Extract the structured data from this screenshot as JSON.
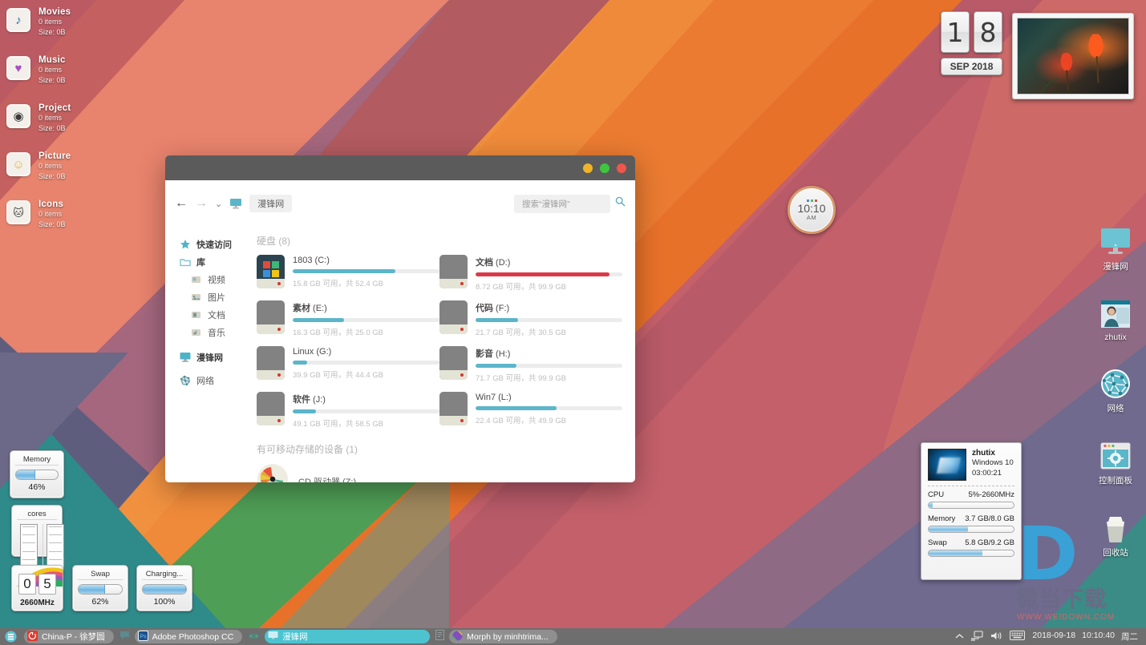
{
  "desktop": {
    "left_icons": [
      {
        "name": "Movies",
        "items": "0 items",
        "size": "Size: 0B",
        "glyph": "♪",
        "icon_color": "#2b6fa8"
      },
      {
        "name": "Music",
        "items": "0 items",
        "size": "Size: 0B",
        "glyph": "♥",
        "icon_color": "#a64ec2"
      },
      {
        "name": "Project",
        "items": "0 items",
        "size": "Size: 0B",
        "glyph": "◉",
        "icon_color": "#3b3b3b"
      },
      {
        "name": "Picture",
        "items": "0 items",
        "size": "Size: 0B",
        "glyph": "😃",
        "icon_color": "#e8b13c"
      },
      {
        "name": "Icons",
        "items": "0 items",
        "size": "Size: 0B",
        "glyph": "🐱",
        "icon_color": "#4a4a4a"
      }
    ],
    "right_icons": [
      {
        "label": "漫锋网",
        "icon": "monitor-icon"
      },
      {
        "label": "zhutix",
        "icon": "user-photo-icon"
      },
      {
        "label": "网络",
        "icon": "network-globe-icon"
      },
      {
        "label": "控制面板",
        "icon": "control-panel-icon"
      },
      {
        "label": "回收站",
        "icon": "recycle-bin-icon"
      }
    ],
    "watermark": {
      "logo": "D",
      "brand": "微当下载",
      "url": "WWW.WEIDOWN.COM"
    }
  },
  "gadgets": {
    "memory": {
      "title": "Memory",
      "value": "46%",
      "percent": 46
    },
    "cores": {
      "title": "cores",
      "core1": "1",
      "core2": "2"
    },
    "cpufreq": {
      "digit1": "0",
      "digit2": "5",
      "label": "2660MHz"
    },
    "swap": {
      "title": "Swap",
      "value": "62%",
      "percent": 62
    },
    "battery": {
      "title": "Charging...",
      "value": "100%",
      "percent": 100
    }
  },
  "calendar": {
    "day1": "1",
    "day2": "8",
    "month_year": "SEP 2018"
  },
  "clock_widget": {
    "time": "10:10",
    "ampm": "AM",
    "dot1": "#4a90d9",
    "dot2": "#5cb85c",
    "dot3": "#d9534f"
  },
  "sysmon": {
    "hostname": "zhutix",
    "os": "Windows 10",
    "uptime": "03:00:21",
    "rows": [
      {
        "label": "CPU",
        "value": "5%-2660MHz",
        "percent": 5
      },
      {
        "label": "Memory",
        "value": "3.7 GB/8.0 GB",
        "percent": 46
      },
      {
        "label": "Swap",
        "value": "5.8 GB/9.2 GB",
        "percent": 63
      }
    ]
  },
  "explorer": {
    "window_buttons": {
      "minimize": "#f0b429",
      "maximize": "#3ec73e",
      "close": "#f0564a"
    },
    "toolbar": {
      "back": "←",
      "forward": "→",
      "history": "⌄",
      "breadcrumb": "漫锋网",
      "search_placeholder": "搜索“漫锋网”"
    },
    "sidebar": [
      {
        "label": "快速访问",
        "icon": "star-icon",
        "bold": false,
        "indent": false
      },
      {
        "label": "库",
        "icon": "library-folder-icon",
        "bold": true,
        "indent": false
      },
      {
        "label": "视频",
        "icon": "video-folder-icon",
        "bold": false,
        "indent": true
      },
      {
        "label": "图片",
        "icon": "pictures-folder-icon",
        "bold": false,
        "indent": true
      },
      {
        "label": "文档",
        "icon": "documents-folder-icon",
        "bold": false,
        "indent": true
      },
      {
        "label": "音乐",
        "icon": "music-folder-icon",
        "bold": false,
        "indent": true
      },
      {
        "label": "漫锋网",
        "icon": "this-pc-icon",
        "bold": true,
        "indent": false
      },
      {
        "label": "网络",
        "icon": "network-icon",
        "bold": false,
        "indent": false
      }
    ],
    "groups": [
      {
        "title": "硬盘",
        "count": "(8)"
      },
      {
        "title": "有可移动存储的设备",
        "count": "(1)"
      }
    ],
    "drives": [
      {
        "name": "1803",
        "letter": "(C:)",
        "bold": false,
        "usage": "15.8 GB 可用，共 52.4 GB",
        "percent": 70,
        "bar_color": "#5cb5c9",
        "system": true
      },
      {
        "name": "文档",
        "letter": "(D:)",
        "bold": true,
        "usage": "8.72 GB 可用，共 99.9 GB",
        "percent": 91,
        "bar_color": "#d83a48",
        "system": false
      },
      {
        "name": "素材",
        "letter": "(E:)",
        "bold": true,
        "usage": "16.3 GB 可用，共 25.0 GB",
        "percent": 35,
        "bar_color": "#5cb5c9",
        "system": false
      },
      {
        "name": "代码",
        "letter": "(F:)",
        "bold": true,
        "usage": "21.7 GB 可用，共 30.5 GB",
        "percent": 29,
        "bar_color": "#5cb5c9",
        "system": false
      },
      {
        "name": "Linux",
        "letter": "(G:)",
        "bold": false,
        "usage": "39.9 GB 可用，共 44.4 GB",
        "percent": 10,
        "bar_color": "#5cb5c9",
        "system": false
      },
      {
        "name": "影音",
        "letter": "(H:)",
        "bold": true,
        "usage": "71.7 GB 可用，共 99.9 GB",
        "percent": 28,
        "bar_color": "#5cb5c9",
        "system": false
      },
      {
        "name": "软件",
        "letter": "(J:)",
        "bold": true,
        "usage": "49.1 GB 可用，共 58.5 GB",
        "percent": 16,
        "bar_color": "#5cb5c9",
        "system": false
      },
      {
        "name": "Win7",
        "letter": "(L:)",
        "bold": false,
        "usage": "22.4 GB 可用，共 49.9 GB",
        "percent": 55,
        "bar_color": "#5cb5c9",
        "system": false
      }
    ],
    "removable": {
      "label": "CD 驱动器 (Z:)"
    }
  },
  "taskbar": {
    "start": "menu-icon",
    "tasks": [
      {
        "label": "China-P - 徐梦圆",
        "active": false,
        "icon_color": "#e03a2f"
      },
      {
        "label": "Adobe Photoshop CC",
        "active": false,
        "icon_color": "#2a6fb0"
      },
      {
        "label": "漫锋网",
        "active": true,
        "icon_color": "#5fc6d8"
      },
      {
        "label": "Morph by minhtrima...",
        "active": false,
        "icon_color": "#8a4fc0"
      }
    ],
    "tray": [
      "chevron-up-icon",
      "network-icon",
      "volume-icon",
      "keyboard-icon"
    ],
    "date": "2018-09-18",
    "time": "10:10:40",
    "weekday": "周二"
  }
}
